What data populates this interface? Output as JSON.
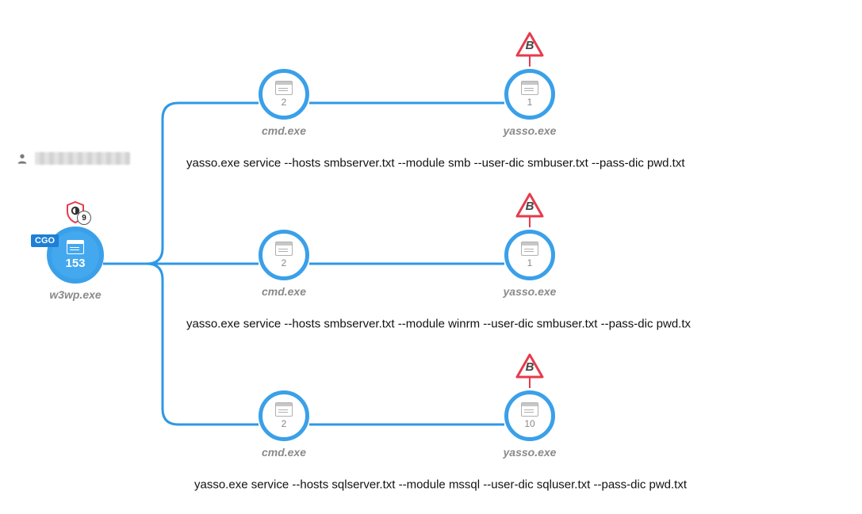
{
  "root": {
    "label": "w3wp.exe",
    "count": "153",
    "tag": "CGO",
    "shield_count": "9"
  },
  "branches": [
    {
      "cmd": {
        "label": "cmd.exe",
        "count": "2"
      },
      "child": {
        "label": "yasso.exe",
        "count": "1",
        "flag": "B"
      },
      "command": "yasso.exe service --hosts smbserver.txt --module smb --user-dic smbuser.txt --pass-dic pwd.txt"
    },
    {
      "cmd": {
        "label": "cmd.exe",
        "count": "2"
      },
      "child": {
        "label": "yasso.exe",
        "count": "1",
        "flag": "B"
      },
      "command": "yasso.exe service --hosts smbserver.txt --module winrm --user-dic smbuser.txt --pass-dic pwd.tx"
    },
    {
      "cmd": {
        "label": "cmd.exe",
        "count": "2"
      },
      "child": {
        "label": "yasso.exe",
        "count": "10",
        "flag": "B"
      },
      "command": "yasso.exe service --hosts sqlserver.txt --module mssql --user-dic sqluser.txt --pass-dic pwd.txt"
    }
  ],
  "colors": {
    "edge": "#2e98e6",
    "danger": "#e63b4c"
  }
}
